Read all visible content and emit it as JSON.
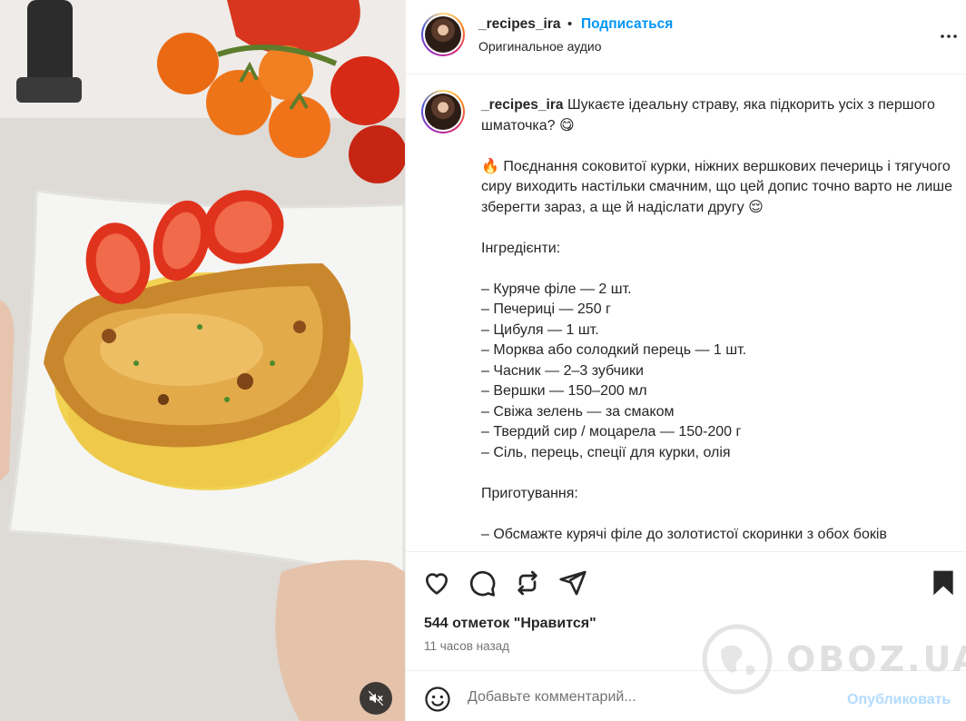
{
  "header": {
    "username": "_recipes_ira",
    "dot": "•",
    "follow_label": "Подписаться",
    "audio_label": "Оригинальное аудио"
  },
  "caption": {
    "username": "_recipes_ira",
    "lines": [
      "Шукаєте ідеальну страву, яка підкорить усіх з першого шматочка? 😋",
      "",
      "🔥 Поєднання соковитої курки, ніжних вершкових печериць і тягучого сиру виходить настільки смачним, що цей допис точно варто не лише зберегти зараз, а ще й надіслати другу 😌",
      "",
      "Інгредієнти:",
      "",
      "– Куряче філе — 2 шт.",
      "– Печериці — 250 г",
      "– Цибуля — 1 шт.",
      "– Морква або солодкий перець — 1 шт.",
      "– Часник — 2–3 зубчики",
      "– Вершки — 150–200 мл",
      "– Свіжа зелень — за смаком",
      "– Твердий сир / моцарела — 150-200 г",
      "– Сіль, перець, спеції для курки, олія",
      "",
      "Приготування:",
      "",
      "– Обсмажте курячі філе до золотистої скоринки з обох боків"
    ]
  },
  "actions": {
    "like_icon": "heart-icon",
    "comment_icon": "comment-icon",
    "repost_icon": "repost-icon",
    "share_icon": "send-icon",
    "save_icon": "bookmark-icon"
  },
  "likes_text": "544 отметок \"Нравится\"",
  "time_text": "11 часов назад",
  "comment": {
    "placeholder": "Добавьте комментарий...",
    "publish_label": "Опубликовать"
  },
  "watermark_text": "OBOZ.UA",
  "colors": {
    "accent": "#0095f6",
    "publish_disabled": "#b3dbff",
    "text": "#262626",
    "muted": "#737373",
    "divider": "#efefef"
  },
  "media": {
    "description_icon": "food-photo",
    "mute_icon": "speaker-muted-icon"
  }
}
